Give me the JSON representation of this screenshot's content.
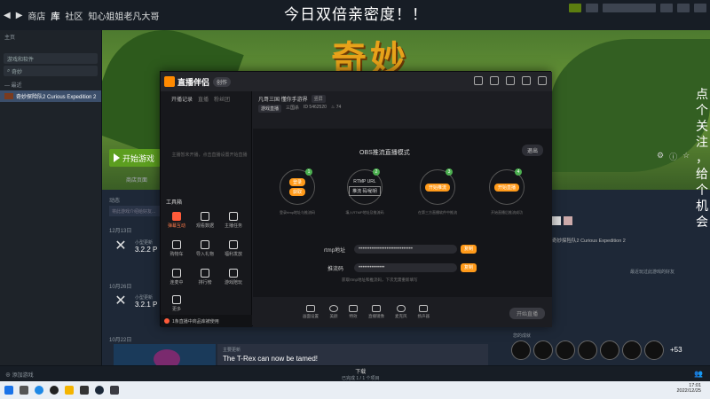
{
  "overlay": {
    "top_text": "今日双倍亲密度！！",
    "side_text": "点个关注，给个机会"
  },
  "steam": {
    "nav": [
      "商店",
      "库",
      "社区",
      "知心姐姐老凡大哥"
    ],
    "sidebar": {
      "home": "主页",
      "filter_label": "游戏和软件",
      "search_value": "奇妙",
      "section": "— 最近",
      "game": "奇妙探险队2 Curious Expedition 2"
    },
    "hero_title": "奇妙",
    "play_label": "开始游戏",
    "store_page": "商店页面",
    "activity_label": "动态",
    "activity_placeholder": "将此游戏介绍给好友...",
    "dates": [
      "12月13日",
      "10月26日",
      "10月22日"
    ],
    "news": [
      {
        "tag": "小型更新",
        "title": "3.2.2 P"
      },
      {
        "tag": "小型更新",
        "title": "3.2.1 P"
      }
    ],
    "news_card": {
      "tag": "主要更新",
      "title": "The T-Rex can now be tamed!"
    },
    "friends_game": "奇妙探险队2 Curious Expedition 2",
    "friends_recent": "最近玩过此游戏的好友",
    "achievements_title": "您的成就",
    "achievements_more": "+53",
    "downloads": "下载",
    "downloads_sub": "已完成 1 / 1 个项目",
    "add_game": "添加游戏"
  },
  "live": {
    "app_name": "直播伴侣",
    "badge": "创作",
    "left_tabs": [
      "开播记录",
      "直播",
      "粉丝团"
    ],
    "left_empty": "主播暂未开播，点击直播设置开始直播",
    "tools_title": "工具箱",
    "tools": [
      "弹幕互动",
      "观看数据",
      "主播任务",
      "购物车",
      "导入礼物",
      "福利发放",
      "连麦中",
      "排行榜",
      "游戏陪玩",
      "更多"
    ],
    "footer": "1条直播中商品库被使用",
    "room_title": "凡哥三国 懂你手游界",
    "room_tag": "竖屏",
    "category": "游戏直播",
    "game_tag": "三国杀",
    "room_id": "ID 5462520",
    "hot": "74",
    "mode_title": "OBS推流直播模式",
    "exit": "退出",
    "steps": [
      {
        "btn": "登录",
        "sub": "获取",
        "caption": "登录rtmp地址与推流码"
      },
      {
        "btn": "RTMP URL",
        "sub": "推流 码/秘钥",
        "caption": "填入RTMP地址及推流码"
      },
      {
        "btn": "开始推流",
        "sub": "",
        "caption": "在第三方直播软件中推流"
      },
      {
        "btn": "开始直播",
        "sub": "",
        "caption": "开始直播后推流成功"
      }
    ],
    "rtmp_label": "rtmp地址",
    "rtmp_value": "•••••••••••••••••••••••••••••",
    "key_label": "推流码",
    "key_value": "••••••••••••••",
    "copy": "复制",
    "hint": "获取rtmp地址和推流码，下次无需重新填写",
    "bottom_tools": [
      "画面设置",
      "美颜",
      "特效",
      "直播镜像",
      "麦克风",
      "扬声器"
    ],
    "start_live": "开始直播"
  },
  "taskbar": {
    "time": "17:01",
    "date": "2022/12/25"
  }
}
